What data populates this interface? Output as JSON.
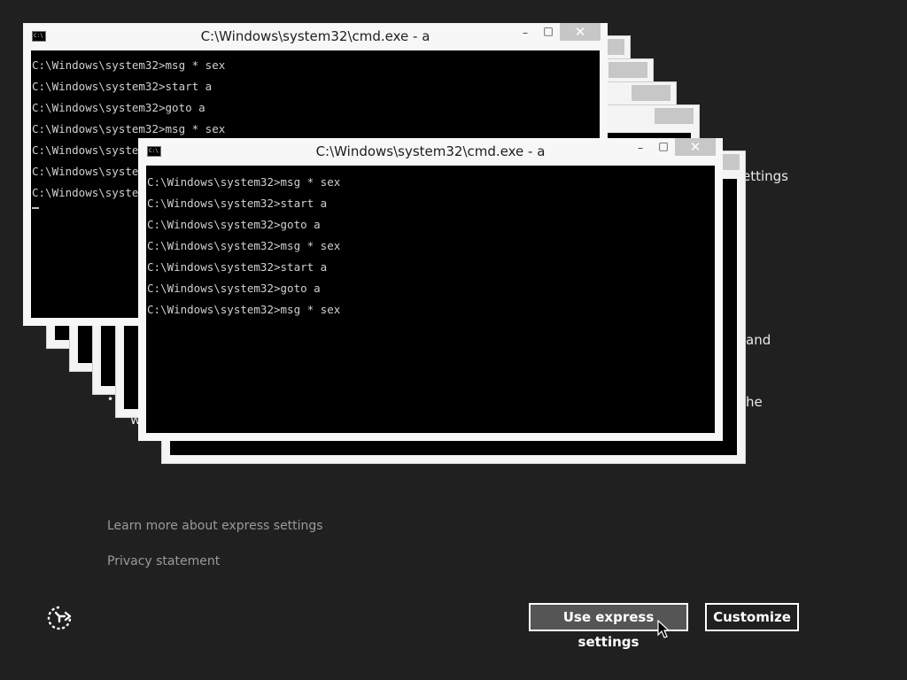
{
  "background": {
    "partial_texts": [
      "ettings",
      "and",
      "he"
    ],
    "bullet": "•",
    "fragment": "w"
  },
  "links": {
    "learn_more": "Learn more about express settings",
    "privacy": "Privacy statement"
  },
  "buttons": {
    "express": "Use express settings",
    "customize": "Customize"
  },
  "icons": {
    "accessibility": "ease-of-access-icon",
    "cursor": "mouse-pointer-icon",
    "console": "cmd-icon"
  },
  "cmd_windows": {
    "icon_text": "C:\\",
    "minimize_glyph": "–",
    "maximize_glyph": "□",
    "close_glyph": "✕",
    "back": {
      "title": "C:\\Windows\\system32\\cmd.exe - a",
      "lines": [
        "C:\\Windows\\system32>msg * sex",
        "C:\\Windows\\system32>start a",
        "C:\\Windows\\system32>goto a",
        "C:\\Windows\\system32>msg * sex",
        "C:\\Windows\\system32>start a",
        "C:\\Windows\\system32>goto a",
        "C:\\Windows\\system32>msg * sex"
      ]
    },
    "front": {
      "title": "C:\\Windows\\system32\\cmd.exe - a",
      "lines": [
        "C:\\Windows\\system32>msg * sex",
        "C:\\Windows\\system32>start a",
        "C:\\Windows\\system32>goto a",
        "C:\\Windows\\system32>msg * sex",
        "C:\\Windows\\system32>start a",
        "C:\\Windows\\system32>goto a",
        "C:\\Windows\\system32>msg * sex"
      ]
    }
  },
  "colors": {
    "background": "#202020",
    "link": "#9a9a9a",
    "window_chrome": "#f7f7f7",
    "console": "#000000",
    "close_inactive": "#c7c7c7"
  }
}
